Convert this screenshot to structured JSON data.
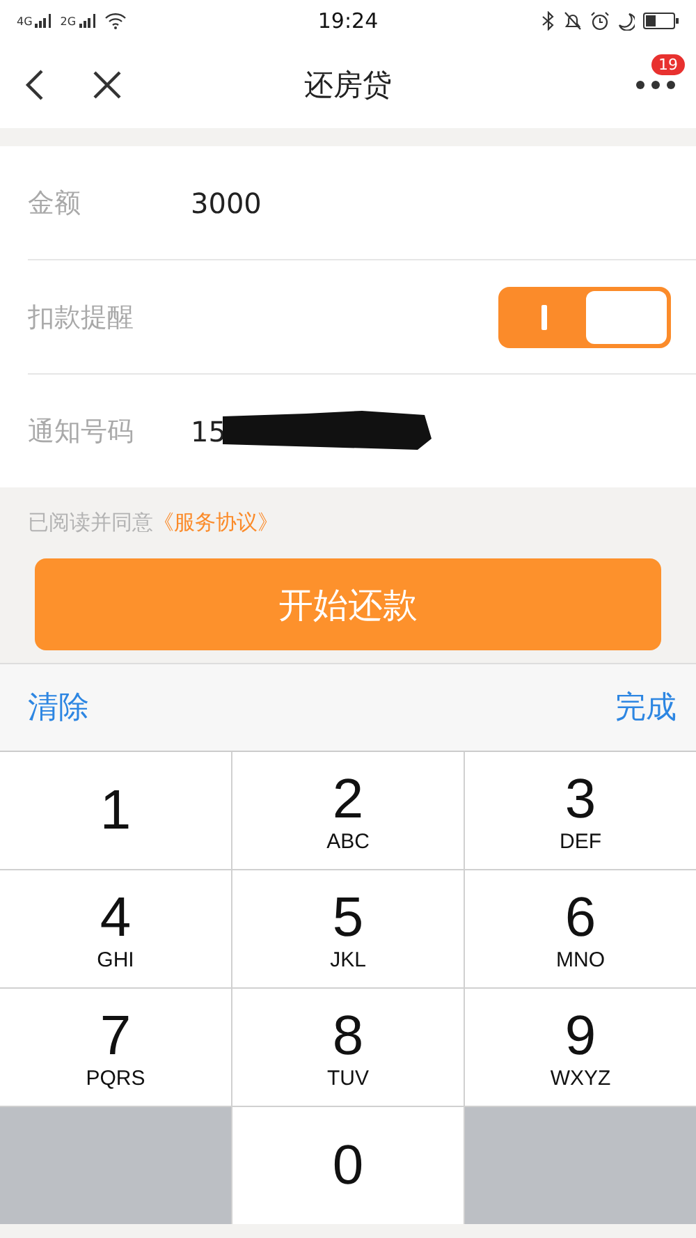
{
  "status_bar": {
    "networks": [
      "4G",
      "2G"
    ],
    "time": "19:24"
  },
  "nav": {
    "title": "还房贷",
    "badge": "19"
  },
  "form": [
    {
      "kind": "text",
      "label": "金额",
      "value": "3000"
    },
    {
      "kind": "toggle",
      "label": "扣款提醒",
      "on": true
    },
    {
      "kind": "redacted",
      "label": "通知号码",
      "value": "15"
    }
  ],
  "agreement": {
    "text": "已阅读并同意",
    "link": "《服务协议》"
  },
  "submit": "开始还款",
  "keyboard_bar": {
    "clear": "清除",
    "done": "完成"
  },
  "keys": [
    {
      "digit": "1"
    },
    {
      "digit": "2",
      "letters": "ABC"
    },
    {
      "digit": "3",
      "letters": "DEF"
    },
    {
      "digit": "4",
      "letters": "GHI"
    },
    {
      "digit": "5",
      "letters": "JKL"
    },
    {
      "digit": "6",
      "letters": "MNO"
    },
    {
      "digit": "7",
      "letters": "PQRS"
    },
    {
      "digit": "8",
      "letters": "TUV"
    },
    {
      "digit": "9",
      "letters": "WXYZ"
    },
    {
      "kind": "blank"
    },
    {
      "digit": "0"
    },
    {
      "kind": "blank"
    }
  ]
}
